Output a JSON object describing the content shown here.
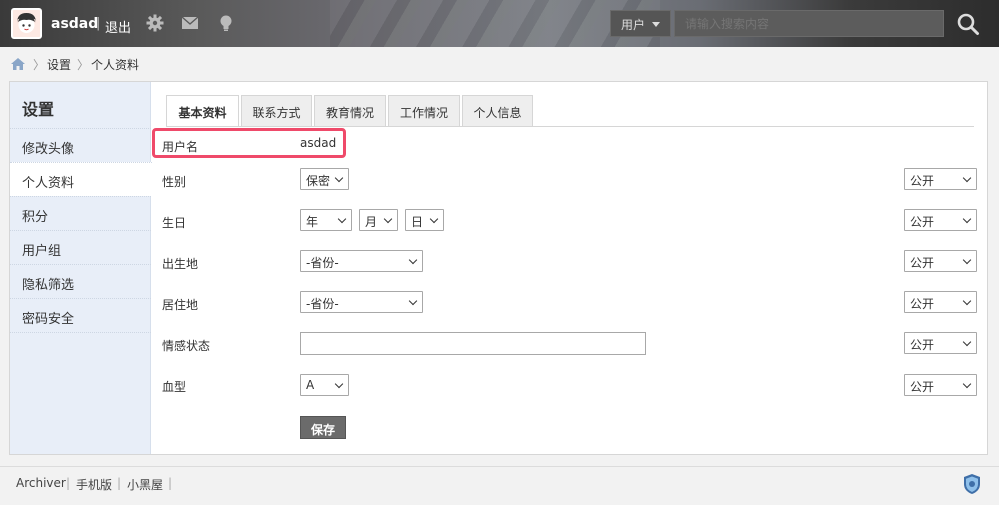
{
  "header": {
    "username": "asdad",
    "logout": "退出",
    "search_scope": "用户",
    "search_placeholder": "请输入搜索内容"
  },
  "breadcrumb": {
    "items": [
      "设置",
      "个人资料"
    ]
  },
  "sidebar": {
    "title": "设置",
    "items": [
      "修改头像",
      "个人资料",
      "积分",
      "用户组",
      "隐私筛选",
      "密码安全"
    ],
    "active": "个人资料"
  },
  "tabs": [
    "基本资料",
    "联系方式",
    "教育情况",
    "工作情况",
    "个人信息"
  ],
  "form": {
    "username": {
      "label": "用户名",
      "value": "asdad"
    },
    "gender": {
      "label": "性别",
      "value": "保密",
      "privacy": "公开"
    },
    "birthday": {
      "label": "生日",
      "year": "年",
      "month": "月",
      "day": "日",
      "privacy": "公开"
    },
    "birthplace": {
      "label": "出生地",
      "value": "-省份-",
      "privacy": "公开"
    },
    "residence": {
      "label": "居住地",
      "value": "-省份-",
      "privacy": "公开"
    },
    "relationship": {
      "label": "情感状态",
      "value": "",
      "privacy": "公开"
    },
    "blood_type": {
      "label": "血型",
      "value": "A",
      "privacy": "公开"
    },
    "save_label": "保存"
  },
  "footer": {
    "links": [
      "Archiver",
      "手机版",
      "小黑屋"
    ]
  },
  "colors": {
    "highlight": "#ef4a6a",
    "sidebar_bg": "#e8eef8"
  }
}
